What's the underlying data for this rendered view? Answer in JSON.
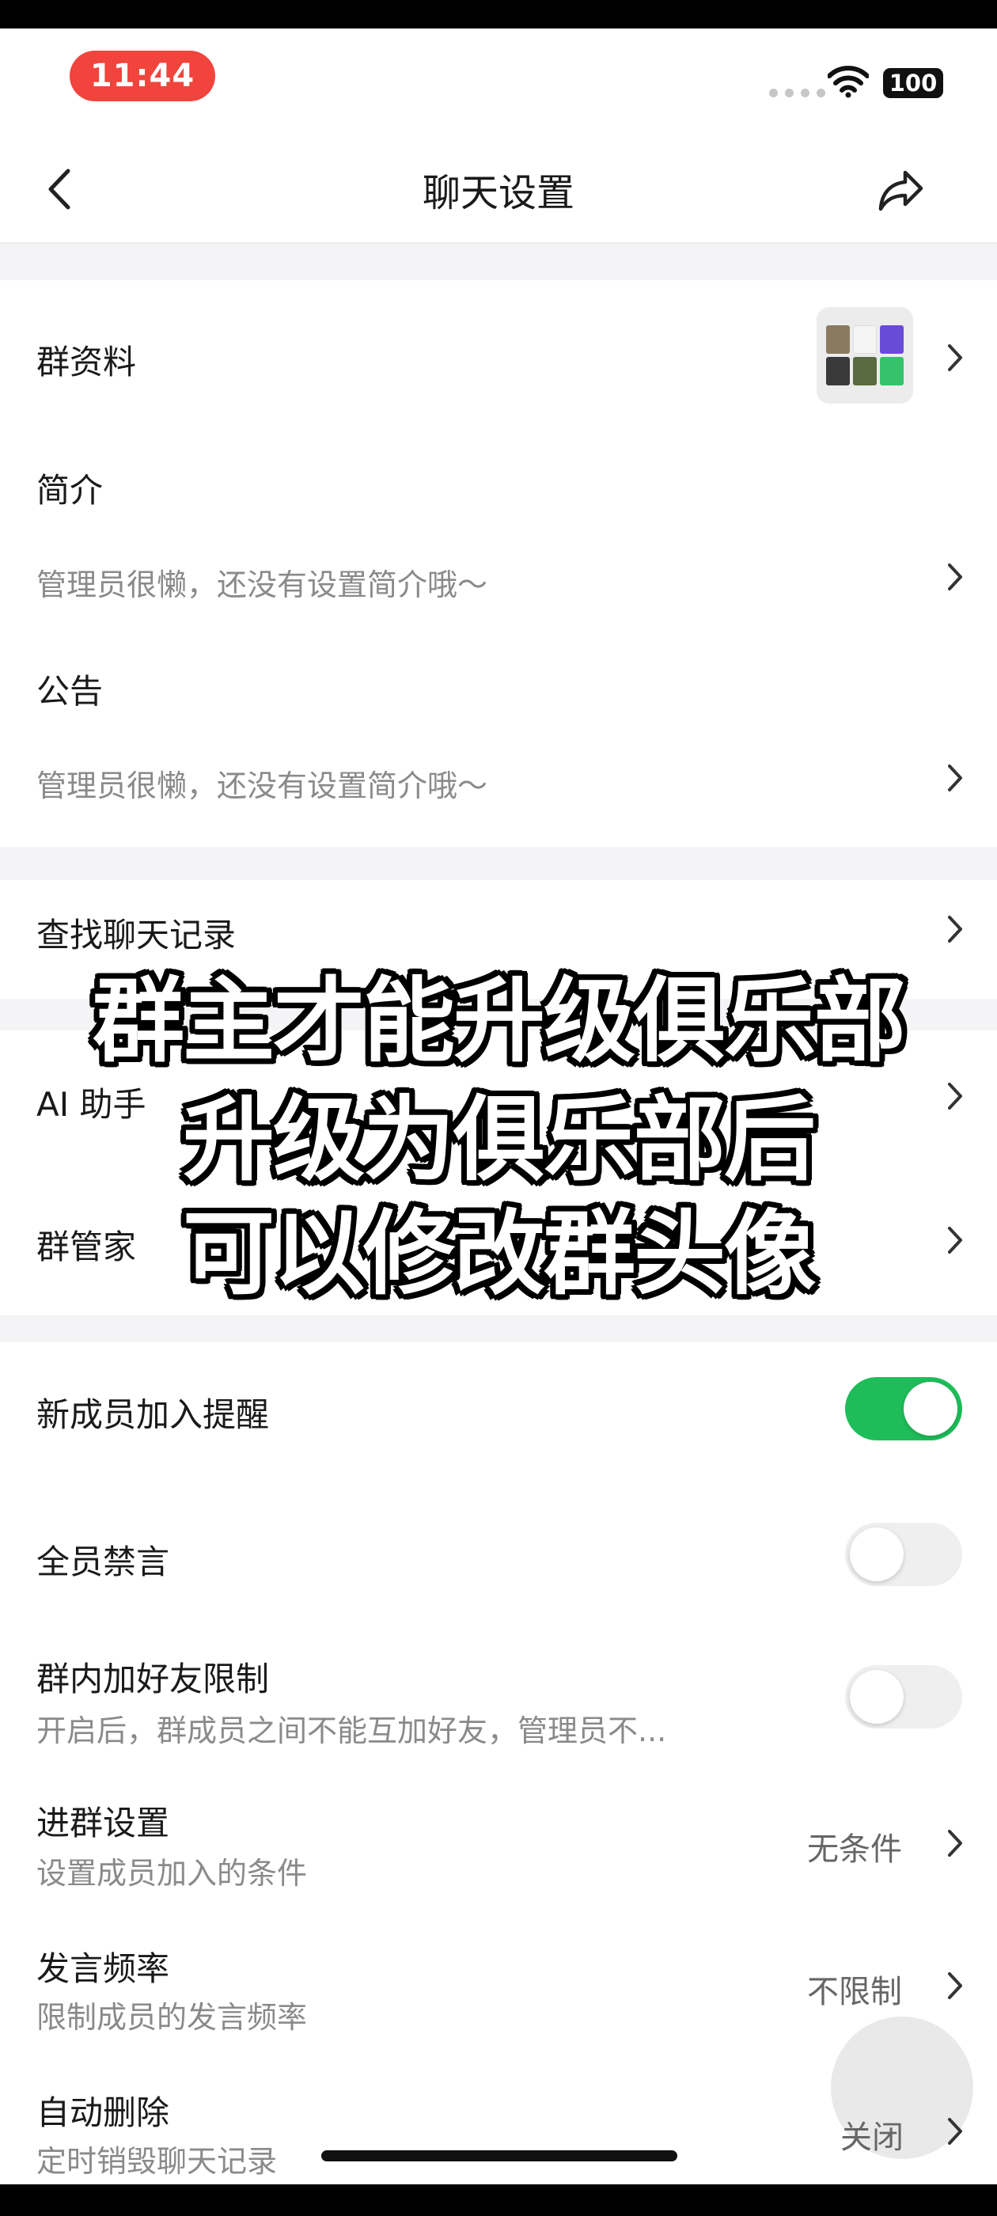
{
  "status_bar": {
    "time": "11:44",
    "battery": "100"
  },
  "nav": {
    "title": "聊天设置"
  },
  "group_profile": {
    "label": "群资料"
  },
  "intro": {
    "label": "简介",
    "text": "管理员很懒，还没有设置简介哦～"
  },
  "notice": {
    "label": "公告",
    "text": "管理员很懒，还没有设置简介哦～"
  },
  "search_history": {
    "label": "查找聊天记录"
  },
  "ai_assistant": {
    "label": "AI 助手"
  },
  "group_manager": {
    "label": "群管家"
  },
  "new_member_alert": {
    "label": "新成员加入提醒",
    "enabled": true
  },
  "mute_all": {
    "label": "全员禁言",
    "enabled": false
  },
  "friend_limit": {
    "label": "群内加好友限制",
    "desc": "开启后，群成员之间不能互加好友，管理员不...",
    "enabled": false
  },
  "join_settings": {
    "label": "进群设置",
    "desc": "设置成员加入的条件",
    "value": "无条件"
  },
  "speak_rate": {
    "label": "发言频率",
    "desc": "限制成员的发言频率",
    "value": "不限制"
  },
  "auto_delete": {
    "label": "自动删除",
    "desc": "定时销毁聊天记录",
    "value": "关闭"
  },
  "overlay": {
    "line1": "群主才能升级俱乐部",
    "line2": "升级为俱乐部后",
    "line3": "可以修改群头像"
  },
  "colors": {
    "toggle_on": "#1fbd5a",
    "time_pill": "#f0443c"
  },
  "icons": [
    "chevron-left-icon",
    "share-icon",
    "wifi-icon",
    "chevron-right-icon"
  ]
}
